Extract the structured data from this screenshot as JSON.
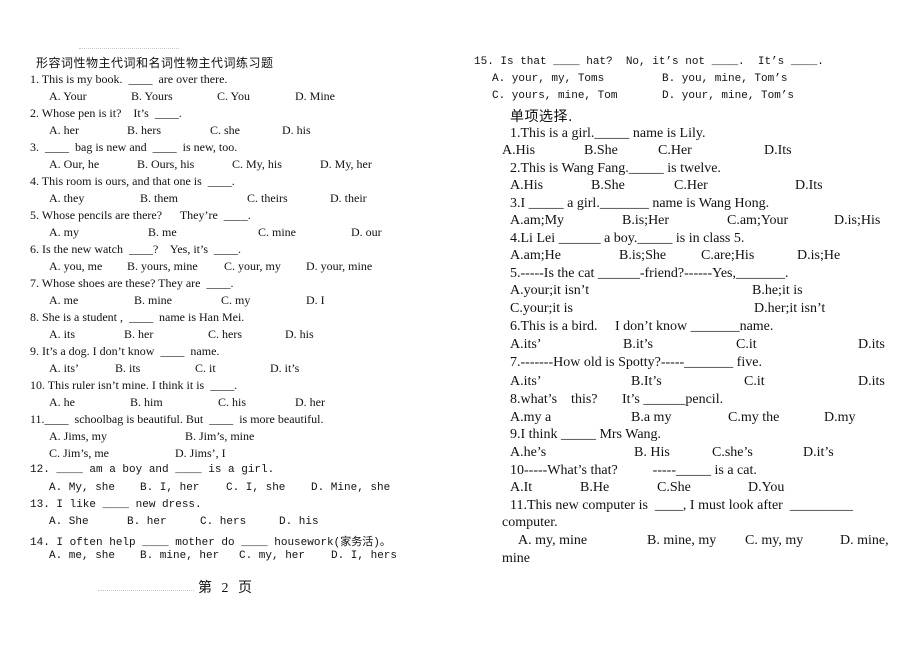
{
  "title": "形容词性物主代词和名词性物主代词练习题",
  "left_questions": [
    {
      "q": "1. This is my book.  ____  are over there.",
      "options": [
        "A. Your",
        "B. Yours",
        "C. You",
        "D. Mine"
      ]
    },
    {
      "q": "2. Whose pen is it?    It’s  ____.",
      "options": [
        "A. her",
        "B. hers",
        "C. she",
        "D. his"
      ]
    },
    {
      "q": "3.  ____  bag is new and  ____  is new, too.",
      "options": [
        "A. Our, he",
        "B. Ours, his",
        "C. My, his",
        "D. My, her"
      ]
    },
    {
      "q": "4. This room is ours, and that one is  ____.",
      "options": [
        "A. they",
        "B. them",
        "C. theirs",
        "D. their"
      ]
    },
    {
      "q": "5. Whose pencils are there?      They’re  ____.",
      "options": [
        "A. my",
        "B. me",
        "C. mine",
        "D. our"
      ]
    },
    {
      "q": "6. Is the new watch  ____?    Yes, it’s  ____.",
      "options": [
        "A. you, me",
        "B. yours, mine",
        "C. your, my",
        "D. your, mine"
      ]
    },
    {
      "q": "7. Whose shoes are these? They are  ____.",
      "options": [
        "A. me",
        "B. mine",
        "C. my",
        "D. I"
      ]
    },
    {
      "q": "8. She is a student ,  ____  name is Han Mei.",
      "options": [
        "A. its",
        "B. her",
        "C. hers",
        "D. his"
      ]
    },
    {
      "q": "9. It’s a dog. I don’t know  ____  name.",
      "options": [
        "A. its’",
        "B. its",
        "C. it",
        "D. it’s"
      ]
    },
    {
      "q": "10. This ruler isn’t mine. I think it is  ____.",
      "options": [
        "A. he",
        "B. him",
        "C. his",
        "D. her"
      ]
    },
    {
      "q": "11.____  schoolbag is beautiful. But  ____  is more beautiful.",
      "options": [
        "A. Jims, my",
        "B. Jim’s, mine",
        "C. Jim’s, me",
        "D. Jims’, I"
      ]
    },
    {
      "q": "12. ____ am a boy and ____ is a girl.",
      "options": [
        "A. My, she",
        "B. I, her",
        "C. I, she",
        "D. Mine, she"
      ]
    },
    {
      "q": "13. I like ____ new dress.",
      "options": [
        "A. She",
        "B. her",
        "C. hers",
        "D. his"
      ]
    },
    {
      "q": "14. I often help ____ mother do ____ housework(家务活)。",
      "options": [
        "A. me, she",
        "B. mine, her",
        "C. my, her",
        "D. I, hers"
      ]
    }
  ],
  "q15": {
    "q": "15. Is that ____ hat?  No, it’s not ____.  It’s ____.",
    "options": [
      "A. your, my, Toms",
      "B. you, mine, Tom’s",
      "C. yours, mine, Tom",
      "D. your, mine, Tom’s"
    ]
  },
  "section_title": "单项选择.",
  "right_questions": [
    {
      "q": "1.This is a girl._____ name is Lily.",
      "options": [
        "A.His",
        "B.She",
        "C.Her",
        "D.Its"
      ]
    },
    {
      "q": "2.This is Wang Fang._____ is twelve.",
      "options": [
        "A.His",
        "B.She",
        "C.Her",
        "D.Its"
      ]
    },
    {
      "q": "3.I _____ a girl._______ name is Wang Hong.",
      "options": [
        "A.am;My",
        "B.is;Her",
        "C.am;Your",
        "D.is;His"
      ]
    },
    {
      "q": "4.Li Lei ______ a boy._____ is in class 5.",
      "options": [
        "A.am;He",
        "B.is;She",
        "C.are;His",
        "D.is;He"
      ]
    },
    {
      "q": "5.-----Is the cat ______-friend?------Yes,_______.",
      "options": [
        "A.your;it isn’t",
        "B.he;it is",
        "C.your;it is",
        "D.her;it isn’t"
      ]
    },
    {
      "q": "6.This is a bird.     I don’t know _______name.",
      "options": [
        "A.its’",
        "B.it’s",
        "C.it",
        "D.its"
      ]
    },
    {
      "q": "7.-------How old is Spotty?-----_______ five.",
      "options": [
        "A.its’",
        "B.It’s",
        "C.it",
        "D.its"
      ]
    },
    {
      "q": "8.what’s    this?       It’s ______pencil.",
      "options": [
        "A.my a",
        "B.a my",
        "C.my the",
        "D.my"
      ]
    },
    {
      "q": "9.I think _____ Mrs Wang.",
      "options": [
        "A.he’s",
        "B. His",
        "C.she’s",
        "D.it’s"
      ]
    },
    {
      "q": "10-----What’s that?          -----_____ is a cat.",
      "options": [
        "A.It",
        "B.He",
        "C.She",
        "D.You"
      ]
    },
    {
      "q": "11.This new computer is  ____, I must look after  _________",
      "q_cont": "computer.",
      "options": [
        "A. my, mine",
        "B. mine, my",
        "C. my, my",
        "D. mine,"
      ],
      "opt_cont": "mine"
    }
  ],
  "footer": "第 2 页"
}
